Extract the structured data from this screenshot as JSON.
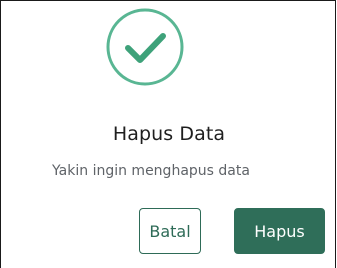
{
  "dialog": {
    "title": "Hapus Data",
    "message": "Yakin ingin menghapus data",
    "icon": "check-circle-icon",
    "buttons": {
      "cancel_label": "Batal",
      "confirm_label": "Hapus"
    },
    "colors": {
      "accent": "#2f6e59",
      "icon_green": "#3ea27a",
      "icon_ring": "#59b693"
    }
  }
}
